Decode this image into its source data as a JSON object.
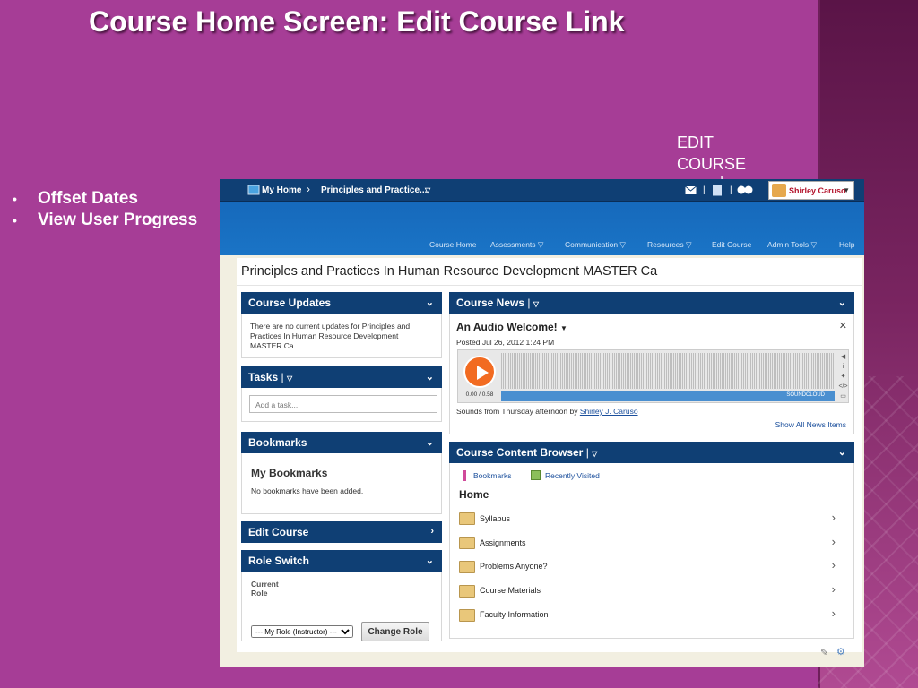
{
  "slide": {
    "title": "Course Home Screen: Edit Course Link",
    "bullets": [
      "Offset Dates",
      "View User Progress"
    ],
    "bullet_glyph": "•",
    "callout": [
      "EDIT",
      "COURSE"
    ]
  },
  "topbar": {
    "my_home": "My Home",
    "breadcrumb": "Principles and Practice...",
    "user_name": "Shirley Caruso"
  },
  "nav": [
    "Course Home",
    "Assessments",
    "Communication",
    "Resources",
    "Edit Course",
    "Admin Tools",
    "Help"
  ],
  "course_title": "Principles and Practices In Human Resource Development MASTER Ca",
  "course_updates": {
    "header": "Course Updates",
    "text": "There are no current updates for Principles and Practices In Human Resource Development MASTER Ca"
  },
  "tasks": {
    "header": "Tasks",
    "placeholder": "Add a task..."
  },
  "bookmarks": {
    "header": "Bookmarks",
    "title": "My Bookmarks",
    "empty": "No bookmarks have been added."
  },
  "edit_course": {
    "header": "Edit Course"
  },
  "role_switch": {
    "header": "Role Switch",
    "label1": "Current",
    "label2": "Role",
    "select_value": "--- My Role (Instructor) ---",
    "button": "Change Role"
  },
  "news": {
    "header": "Course News",
    "item_title": "An Audio Welcome!",
    "posted": "Posted Jul 26, 2012 1:24 PM",
    "time": "0.00 / 0.58",
    "player_brand": "SOUNDCLOUD",
    "caption_prefix": "Sounds from Thursday afternoon by",
    "caption_link": "Shirley J. Caruso",
    "show_all": "Show All News Items"
  },
  "browser": {
    "header": "Course Content Browser",
    "bookmarks_link": "Bookmarks",
    "recent_link": "Recently Visited",
    "home": "Home",
    "items": [
      "Syllabus",
      "Assignments",
      "Problems Anyone?",
      "Course Materials",
      "Faculty Information"
    ]
  },
  "colors": {
    "slide_bg": "#a63d96",
    "header_blue": "#0f3f74",
    "banner_blue": "#1a74c6",
    "play_orange": "#f26b21"
  }
}
